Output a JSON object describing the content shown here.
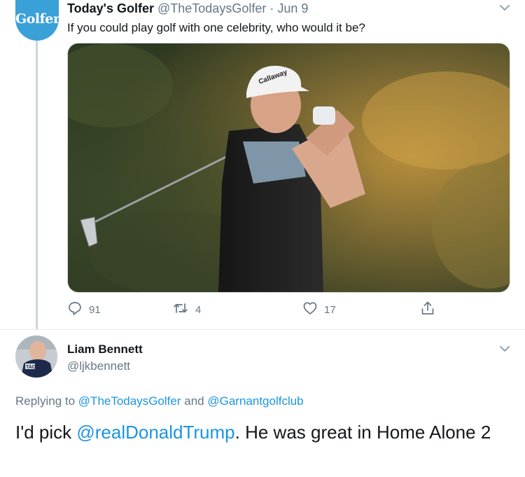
{
  "original_tweet": {
    "author_name": "Today's Golfer",
    "author_handle": "@TheTodaysGolfer",
    "separator": "·",
    "date": "Jun 9",
    "avatar_logo_text": "Golfer",
    "text": "If you could play golf with one celebrity, who would it be?",
    "image_cap_text": "Callaway",
    "reply_count": "91",
    "retweet_count": "4",
    "like_count": "17",
    "icons": [
      "reply-icon",
      "retweet-icon",
      "like-icon",
      "share-icon",
      "chevron-down-icon"
    ]
  },
  "reply_tweet": {
    "author_name": "Liam Bennett",
    "author_handle": "@ljkbennett",
    "avatar_shirt_text": "TAC",
    "replying_prefix": "Replying to",
    "replying_mention_1": "@TheTodaysGolfer",
    "replying_and": "and",
    "replying_mention_2": "@Garnantgolfclub",
    "text_before": "I'd pick",
    "text_mention": "@realDonaldTrump",
    "text_after": ". He was great in Home Alone 2"
  },
  "colors": {
    "link": "#1b95e0",
    "secondary_text": "#657786",
    "brand_avatar": "#3aa0d8",
    "thread_line": "#ccd6dd"
  }
}
